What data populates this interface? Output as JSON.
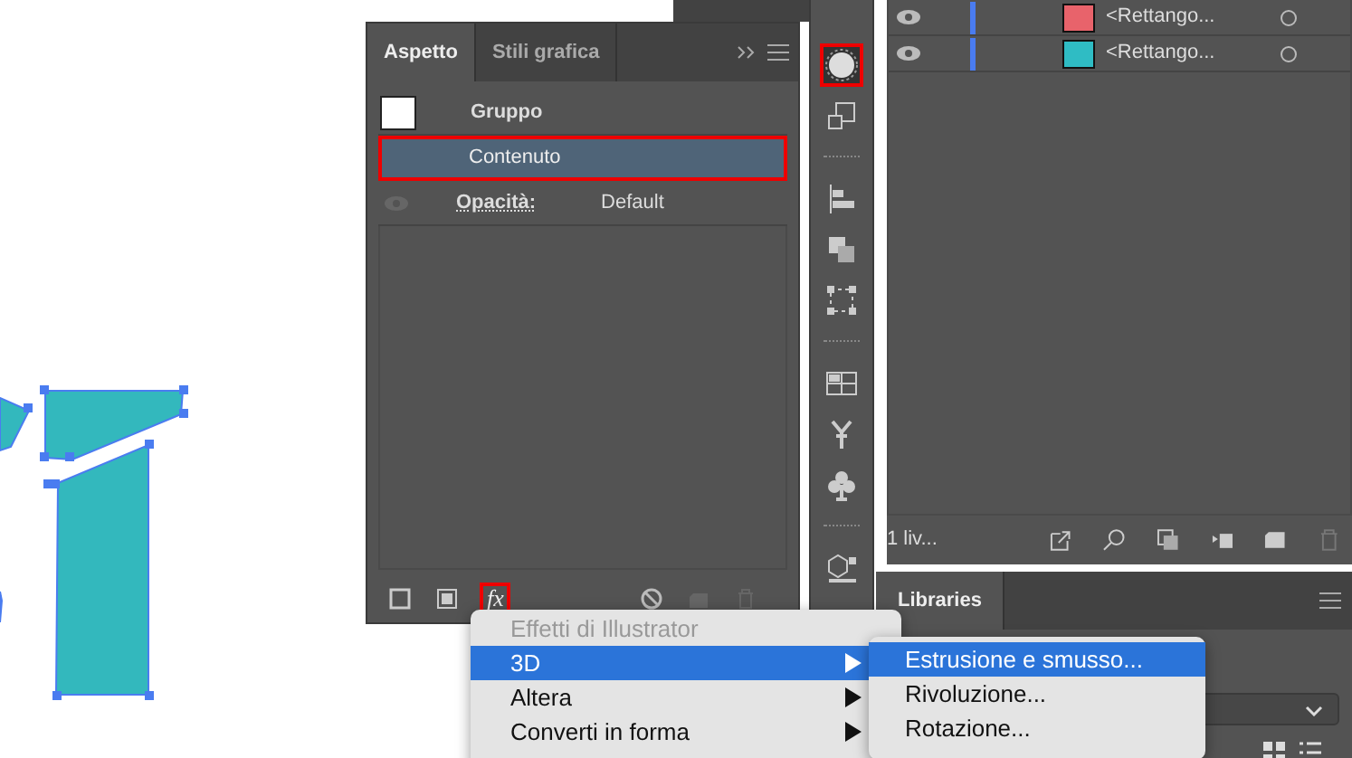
{
  "appearance_panel": {
    "tabs": [
      {
        "label": "Aspetto",
        "selected": true
      },
      {
        "label": "Stili grafica",
        "selected": false
      }
    ],
    "rows": [
      {
        "kind": "group",
        "label": "Gruppo",
        "selected": false
      },
      {
        "kind": "item",
        "label": "Contenuto",
        "selected": true
      },
      {
        "kind": "attribute",
        "label": "Opacità:",
        "value": "Default",
        "selected": false
      }
    ],
    "footer_tools": [
      {
        "kind": "stroke",
        "highlighted": false
      },
      {
        "kind": "fill",
        "highlighted": false
      },
      {
        "kind": "effects",
        "label": "fx",
        "highlighted": true
      },
      {
        "kind": "clear",
        "highlighted": false
      },
      {
        "kind": "duplicate",
        "highlighted": false
      },
      {
        "kind": "trash",
        "highlighted": false
      }
    ]
  },
  "toolbar": [
    {
      "kind": "appearance",
      "highlighted": true
    },
    {
      "kind": "transform",
      "highlighted": false
    },
    {
      "kind": "align",
      "highlighted": false
    },
    {
      "kind": "pathfinder",
      "highlighted": false
    },
    {
      "kind": "transform-box",
      "highlighted": false
    },
    {
      "kind": "swatches",
      "highlighted": false
    },
    {
      "kind": "brush",
      "highlighted": false
    },
    {
      "kind": "club",
      "highlighted": false
    },
    {
      "kind": "cube",
      "highlighted": false
    }
  ],
  "layers_panel": {
    "rows": [
      {
        "label": "<Rettango...",
        "color": "#e8636b"
      },
      {
        "label": "<Rettango...",
        "color": "#2fbcc4"
      }
    ],
    "footer": "1 liv..."
  },
  "libraries_panel": {
    "tabs": [
      {
        "label": "Libraries",
        "selected": true
      }
    ]
  },
  "context_menu": {
    "items": [
      {
        "label": "Effetti di Illustrator",
        "disabled": true,
        "selected": false,
        "submenu": false
      },
      {
        "label": "3D",
        "disabled": false,
        "selected": true,
        "submenu": true
      },
      {
        "label": "Altera",
        "disabled": false,
        "selected": false,
        "submenu": true
      },
      {
        "label": "Converti in forma",
        "disabled": false,
        "selected": false,
        "submenu": true
      }
    ]
  },
  "submenu": {
    "items": [
      {
        "label": "Estrusione e smusso...",
        "selected": true
      },
      {
        "label": "Rivoluzione...",
        "selected": false
      },
      {
        "label": "Rotazione...",
        "selected": false
      }
    ]
  }
}
